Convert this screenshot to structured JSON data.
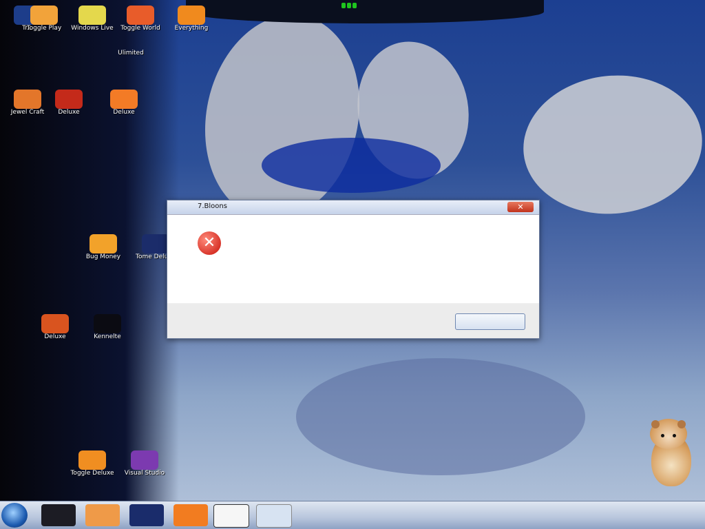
{
  "desktop": {
    "icons": [
      {
        "label": "Tr..."
      },
      {
        "label": "Toggle Play"
      },
      {
        "label": "Windows Live"
      },
      {
        "label": "Toggle World"
      },
      {
        "label": "Everything"
      },
      {
        "label": "Ulimited"
      },
      {
        "label": "Jewel Craft"
      },
      {
        "label": "Deluxe"
      },
      {
        "label": "Deluxe"
      },
      {
        "label": "Bug Money"
      },
      {
        "label": "Tome Deluxe"
      },
      {
        "label": "Deluxe"
      },
      {
        "label": "Kennelte"
      },
      {
        "label": "Toggle Deluxe"
      },
      {
        "label": "Visual Studio"
      }
    ]
  },
  "dialog": {
    "title": "7.Bloons",
    "close_glyph": "✕",
    "error_glyph": "✕",
    "message": "",
    "ok_label": ""
  },
  "taskbar": {
    "tray_text": ""
  }
}
